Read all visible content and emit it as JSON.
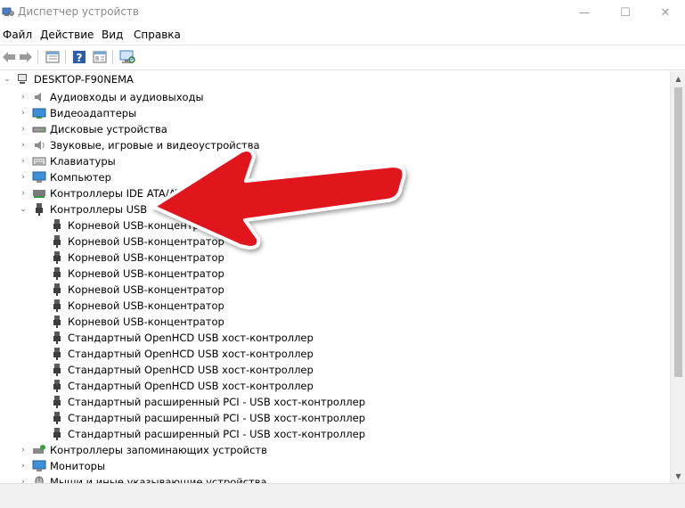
{
  "window": {
    "title": "Диспетчер устройств",
    "controls": {
      "minimize": "—",
      "maximize": "☐",
      "close": "✕"
    }
  },
  "menu": {
    "items": [
      "Файл",
      "Действие",
      "Вид",
      "Справка"
    ]
  },
  "toolbar": {
    "icons": [
      "back-arrow-icon",
      "forward-arrow-icon",
      "properties-grid-icon",
      "help-icon",
      "update-driver-icon",
      "scan-monitor-icon"
    ]
  },
  "tree": {
    "root": "DESKTOP-F90NEMA",
    "categories_top": [
      {
        "label": "Аудиовходы и аудиовыходы",
        "icon": "audio-icon"
      },
      {
        "label": "Видеоадаптеры",
        "icon": "display-adapter-icon"
      },
      {
        "label": "Дисковые устройства",
        "icon": "disk-drive-icon"
      },
      {
        "label": "Звуковые, игровые и видеоустройства",
        "icon": "speaker-icon"
      },
      {
        "label": "Клавиатуры",
        "icon": "keyboard-icon"
      },
      {
        "label": "Компьютер",
        "icon": "computer-icon"
      },
      {
        "label": "Контроллеры IDE ATA/AT",
        "icon": "ide-controller-icon"
      }
    ],
    "usb_category": {
      "label": "Контроллеры USB",
      "icon": "usb-plug-icon"
    },
    "usb_children": [
      "Корневой USB-концентратор",
      "Корневой USB-концентратор",
      "Корневой USB-концентратор",
      "Корневой USB-концентратор",
      "Корневой USB-концентратор",
      "Корневой USB-концентратор",
      "Корневой USB-концентратор",
      "Стандартный OpenHCD USB хост-контроллер",
      "Стандартный OpenHCD USB хост-контроллер",
      "Стандартный OpenHCD USB хост-контроллер",
      "Стандартный OpenHCD USB хост-контроллер",
      "Стандартный расширенный PCI - USB хост-контроллер",
      "Стандартный расширенный PCI - USB хост-контроллер",
      "Стандартный расширенный PCI - USB хост-контроллер"
    ],
    "categories_bottom": [
      {
        "label": "Контроллеры запоминающих устройств",
        "icon": "storage-controller-icon"
      },
      {
        "label": "Мониторы",
        "icon": "monitor-icon"
      },
      {
        "label": "Мыши и иные указывающие устройства",
        "icon": "mouse-icon"
      }
    ]
  },
  "colors": {
    "arrow": "#e0141e",
    "arrow_outline": "#ffffff",
    "title_text": "#8a8a8a",
    "selection_accent": "#0078d7"
  }
}
